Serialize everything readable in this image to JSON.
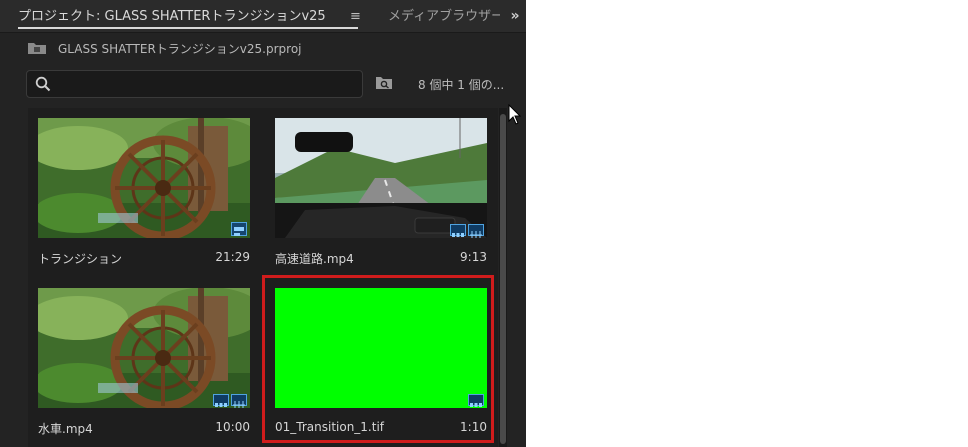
{
  "tabs": {
    "project_tab": "プロジェクト: GLASS SHATTERトランジションv25",
    "menu_glyph": "≡",
    "media_browser_tab": "メディアブラウザー",
    "more_glyph": "»"
  },
  "project": {
    "file_path": "GLASS SHATTERトランジションv25.prproj"
  },
  "search": {
    "placeholder": "",
    "value": ""
  },
  "item_count": "8 個中 1 個の...",
  "items": [
    {
      "name": "トランジション",
      "duration": "21:29",
      "thumbnail": "waterwheel",
      "badges": [
        "sequence-icon"
      ]
    },
    {
      "name": "高速道路.mp4",
      "duration": "9:13",
      "thumbnail": "highway",
      "badges": [
        "video-icon",
        "audio-icon"
      ]
    },
    {
      "name": "水車.mp4",
      "duration": "10:00",
      "thumbnail": "waterwheel",
      "badges": [
        "video-icon",
        "audio-icon"
      ]
    },
    {
      "name": "01_Transition_1.tif",
      "duration": "1:10",
      "thumbnail": "green",
      "badges": [
        "video-icon"
      ],
      "selected": true
    }
  ],
  "colors": {
    "panel_bg": "#232323",
    "selection": "#d01c1c",
    "badge_blue": "#4fa3e0",
    "green_screen": "#00ff00"
  }
}
